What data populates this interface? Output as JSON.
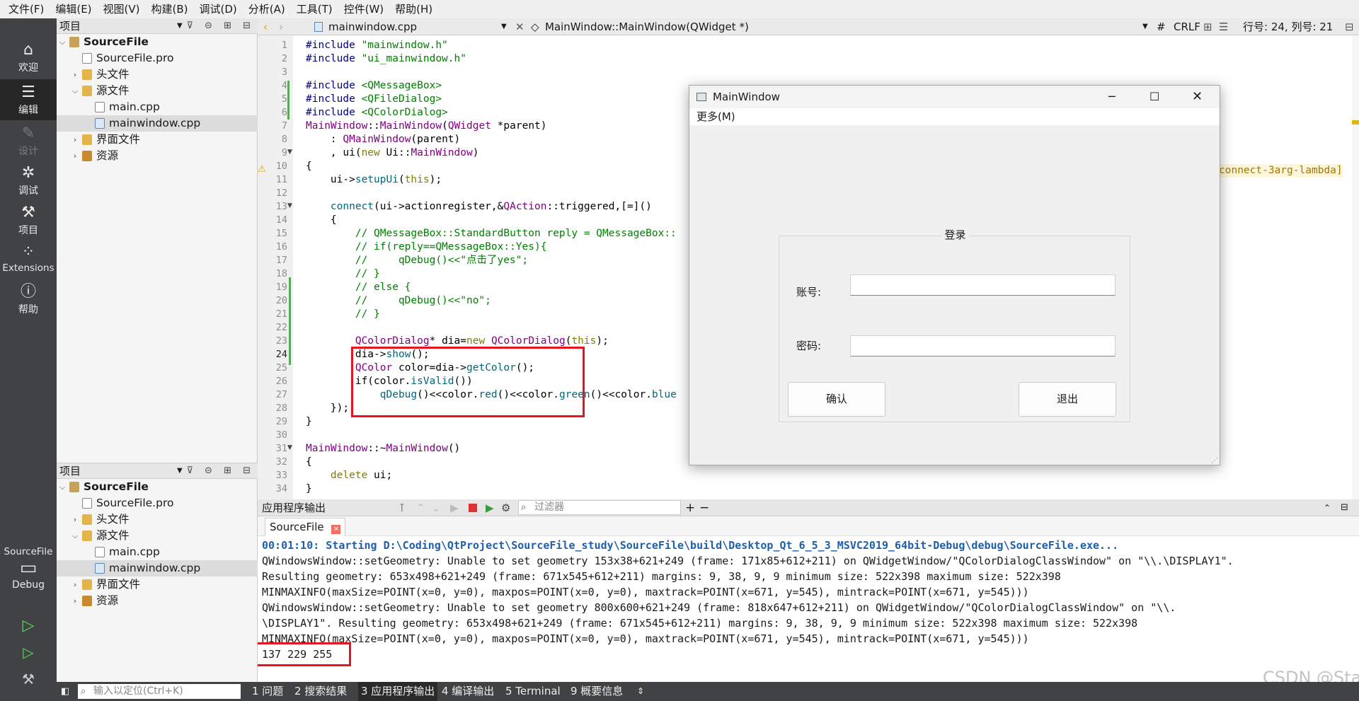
{
  "menubar": [
    "文件(F)",
    "编辑(E)",
    "视图(V)",
    "构建(B)",
    "调试(D)",
    "分析(A)",
    "工具(T)",
    "控件(W)",
    "帮助(H)"
  ],
  "modes": {
    "welcome": "欢迎",
    "edit": "编辑",
    "design": "设计",
    "debug": "调试",
    "project": "项目",
    "extensions": "Extensions",
    "help": "帮助",
    "kit_project": "SourceFile",
    "kit_mode": "Debug"
  },
  "project_panel": {
    "title": "项目",
    "tree": {
      "root": "SourceFile",
      "pro": "SourceFile.pro",
      "headers": "头文件",
      "sources": "源文件",
      "main": "main.cpp",
      "mainwindow": "mainwindow.cpp",
      "forms": "界面文件",
      "resources": "资源"
    }
  },
  "editor_header": {
    "file": "mainwindow.cpp",
    "symbol": "MainWindow::MainWindow(QWidget *)",
    "hash": "#",
    "eol": "CRLF",
    "position": "行号: 24, 列号: 21"
  },
  "warning_hint": "connect-3arg-lambda]",
  "code_lines": [
    "#include \"mainwindow.h\"",
    "#include \"ui_mainwindow.h\"",
    "",
    "#include <QMessageBox>",
    "#include <QFileDialog>",
    "#include <QColorDialog>",
    "MainWindow::MainWindow(QWidget *parent)",
    "    : QMainWindow(parent)",
    "    , ui(new Ui::MainWindow)",
    "{",
    "    ui->setupUi(this);",
    "",
    "    connect(ui->actionregister,&QAction::triggered,[=]()",
    "    {",
    "        // QMessageBox::StandardButton reply = QMessageBox::",
    "        // if(reply==QMessageBox::Yes){",
    "        //     qDebug()<<\"点击了yes\";",
    "        // }",
    "        // else {",
    "        //     qDebug()<<\"no\";",
    "        // }",
    "",
    "        QColorDialog* dia=new QColorDialog(this);",
    "        dia->show();",
    "        QColor color=dia->getColor();",
    "        if(color.isValid())",
    "            qDebug()<<color.red()<<color.green()<<color.blue",
    "    });",
    "}",
    "",
    "MainWindow::~MainWindow()",
    "{",
    "    delete ui;",
    "}"
  ],
  "dialog": {
    "title": "MainWindow",
    "menu": "更多(M)",
    "group_title": "登录",
    "account_label": "账号:",
    "password_label": "密码:",
    "account_value": "",
    "password_value": "",
    "confirm": "确认",
    "exit": "退出"
  },
  "output_pane": {
    "title": "应用程序输出",
    "filter_placeholder": "过滤器",
    "tab": "SourceFile"
  },
  "output_lines": [
    "00:01:10: Starting D:\\Coding\\QtProject\\SourceFile_study\\SourceFile\\build\\Desktop_Qt_6_5_3_MSVC2019_64bit-Debug\\debug\\SourceFile.exe...",
    "QWindowsWindow::setGeometry: Unable to set geometry 153x38+621+249 (frame: 171x85+612+211) on QWidgetWindow/\"QColorDialogClassWindow\" on \"\\\\.\\DISPLAY1\".",
    "Resulting geometry: 653x498+621+249 (frame: 671x545+612+211) margins: 9, 38, 9, 9 minimum size: 522x398 maximum size: 522x398",
    "MINMAXINFO(maxSize=POINT(x=0, y=0), maxpos=POINT(x=0, y=0), maxtrack=POINT(x=671, y=545), mintrack=POINT(x=671, y=545)))",
    "QWindowsWindow::setGeometry: Unable to set geometry 800x600+621+249 (frame: 818x647+612+211) on QWidgetWindow/\"QColorDialogClassWindow\" on \"\\\\.",
    "\\DISPLAY1\". Resulting geometry: 653x498+621+249 (frame: 671x545+612+211) margins: 9, 38, 9, 9 minimum size: 522x398 maximum size: 522x398",
    "MINMAXINFO(maxSize=POINT(x=0, y=0), maxpos=POINT(x=0, y=0), maxtrack=POINT(x=671, y=545), mintrack=POINT(x=671, y=545)))",
    "137 229 255"
  ],
  "statusbar": {
    "locator_placeholder": "输入以定位(Ctrl+K)",
    "tabs": [
      "1 问题",
      "2 搜索结果",
      "3 应用程序输出",
      "4 编译输出",
      "5 Terminal",
      "9 概要信息"
    ]
  },
  "watermark": "CSDN @Stark、"
}
